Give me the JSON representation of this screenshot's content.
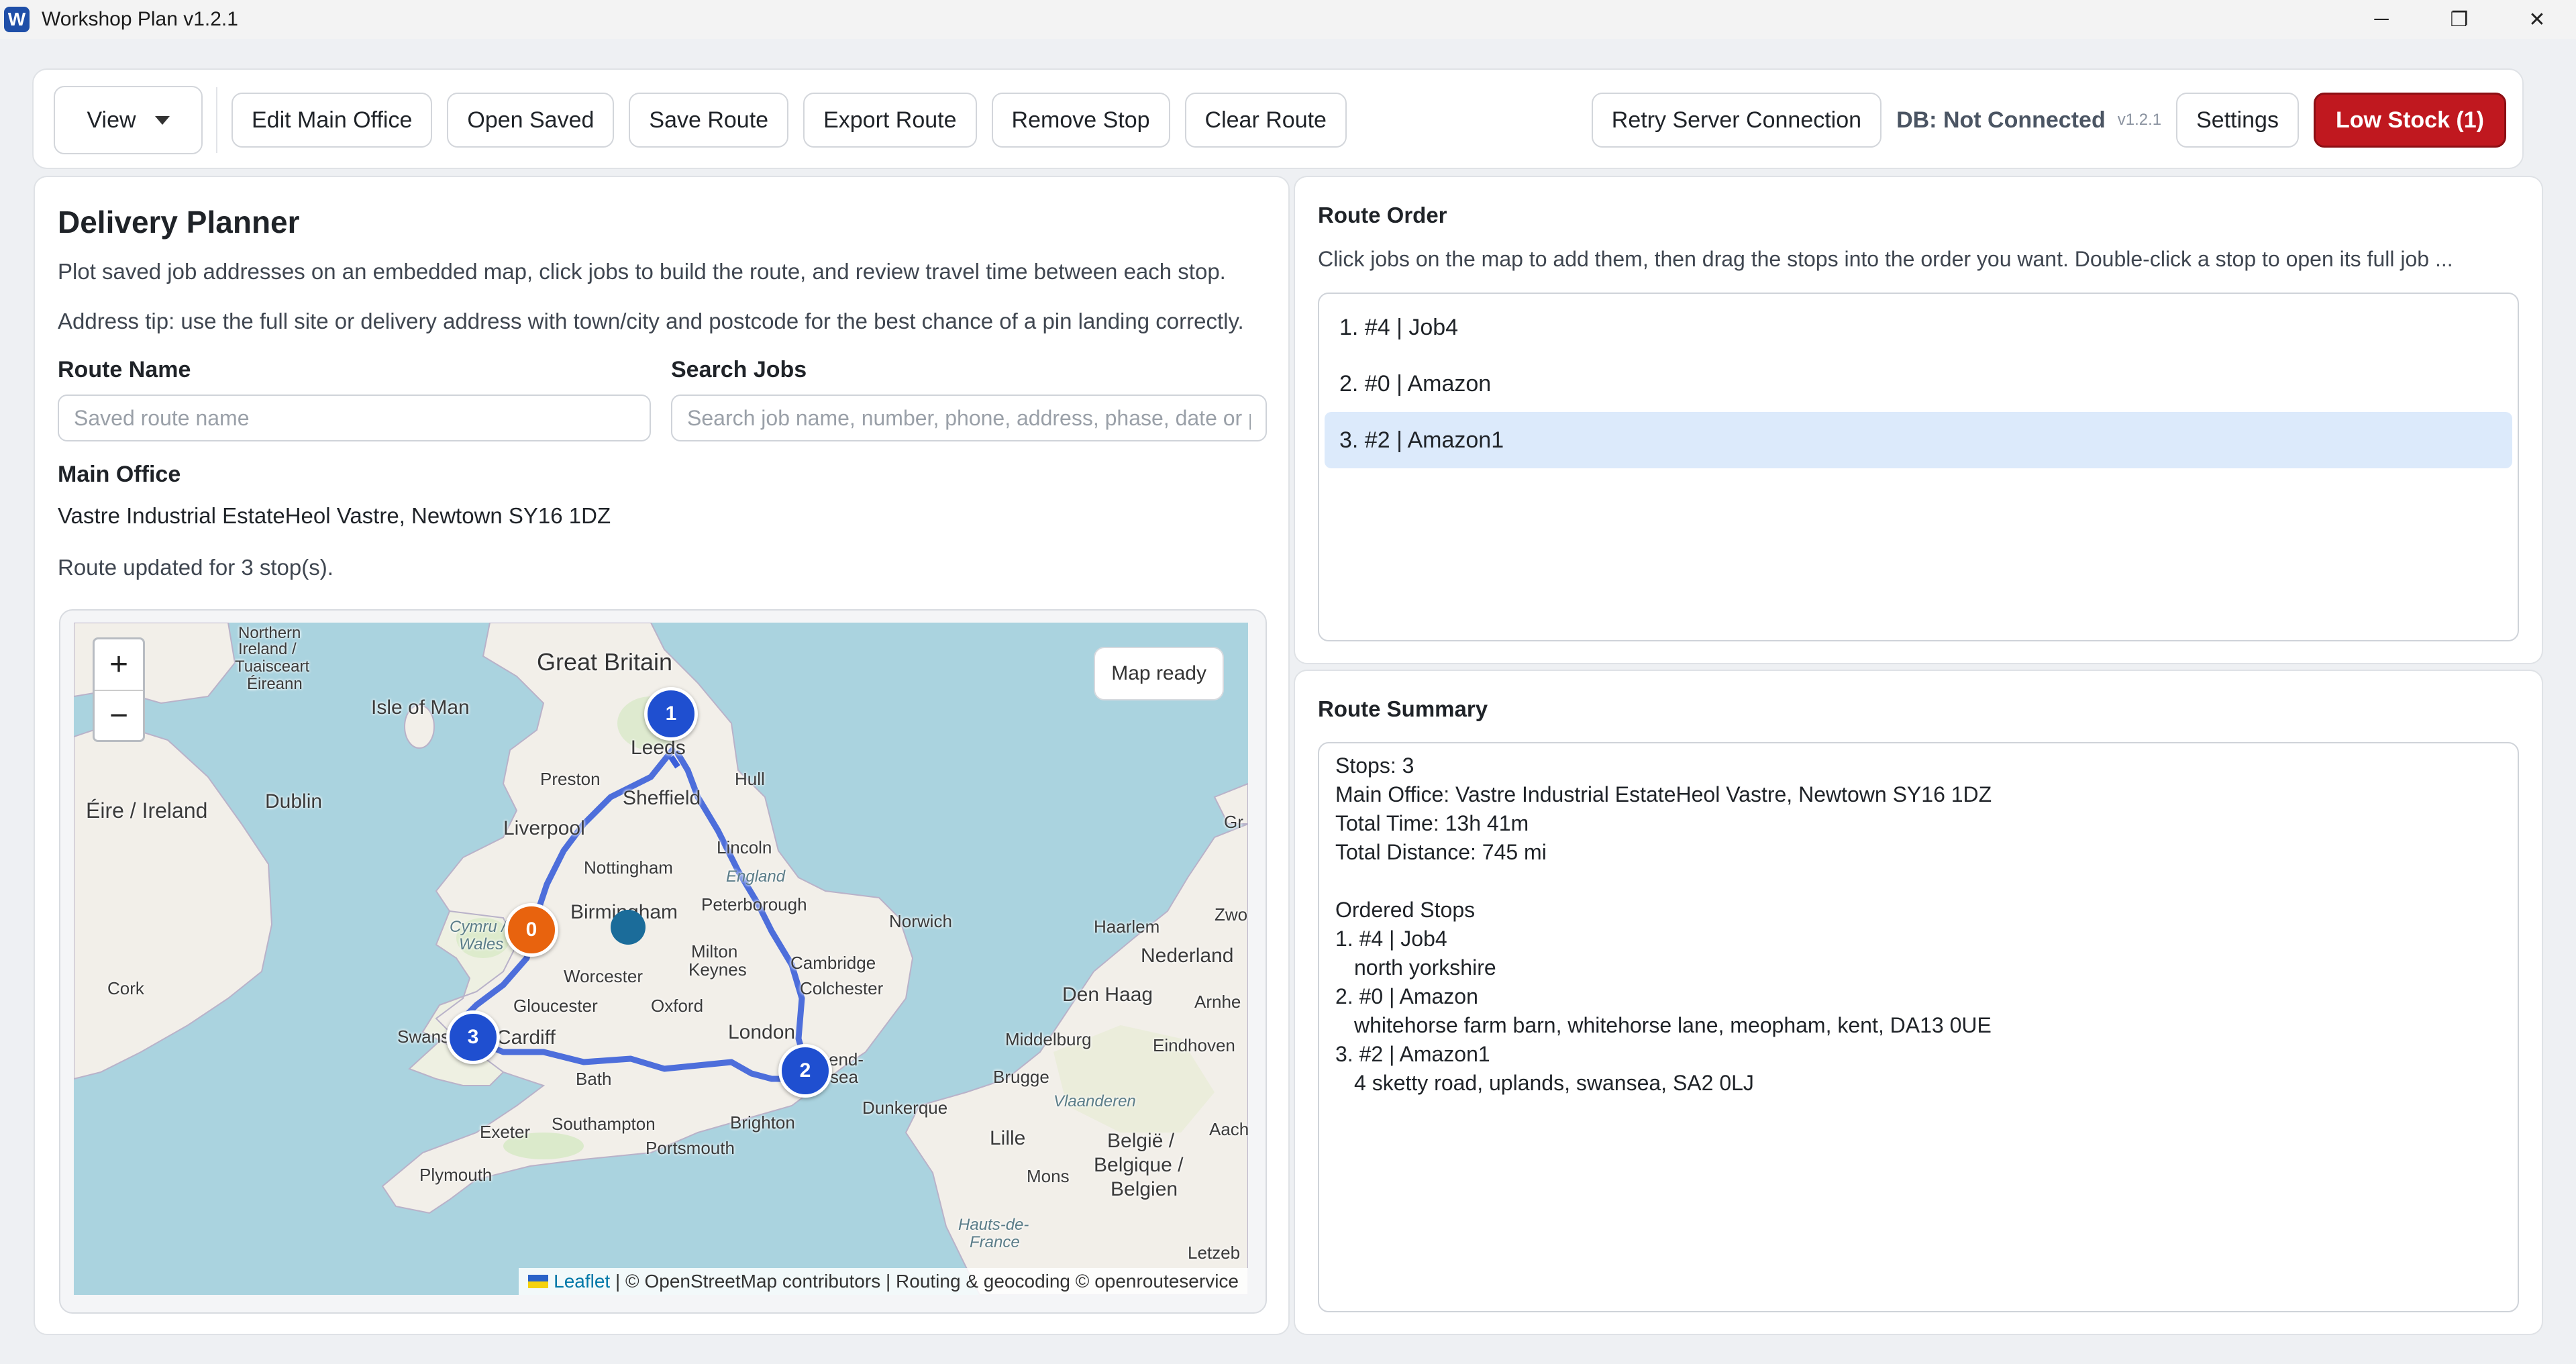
{
  "window": {
    "title": "Workshop Plan v1.2.1",
    "logo_letter": "W",
    "minimize": "─",
    "restore": "❐",
    "close": "✕"
  },
  "toolbar": {
    "view_label": "View",
    "edit_main_office": "Edit Main Office",
    "open_saved": "Open Saved",
    "save_route": "Save Route",
    "export_route": "Export Route",
    "remove_stop": "Remove Stop",
    "clear_route": "Clear Route",
    "retry_server": "Retry Server Connection",
    "db_status": "DB: Not Connected",
    "version": "v1.2.1",
    "settings": "Settings",
    "low_stock": "Low Stock (1)",
    "low_stock_color": "#c0181f"
  },
  "planner": {
    "title": "Delivery Planner",
    "description": "Plot saved job addresses on an embedded map, click jobs to build the route, and review travel time between each stop.",
    "address_tip": "Address tip: use the full site or delivery address with town/city and postcode for the best chance of a pin landing correctly.",
    "route_name_label": "Route Name",
    "route_name_value": "",
    "route_name_placeholder": "Saved route name",
    "search_label": "Search Jobs",
    "search_value": "",
    "search_placeholder": "Search job name, number, phone, address, phase, date or p",
    "main_office_label": "Main Office",
    "main_office_address": "Vastre Industrial EstateHeol Vastre, Newtown SY16 1DZ",
    "route_status": "Route updated for 3 stop(s)."
  },
  "map": {
    "zoom_in": "+",
    "zoom_out": "−",
    "status": "Map ready",
    "attribution_leaflet": "Leaflet",
    "attribution_rest": " | © OpenStreetMap contributors | Routing & geocoding © openrouteservice",
    "route_color": "#3b5fd9",
    "labels": {
      "great_britain": "Great Britain",
      "isle_of_man": "Isle of Man",
      "eire": "Éire / Ireland",
      "dublin": "Dublin",
      "cork": "Cork",
      "northern_ireland": "Northern",
      "ireland_n": "Ireland /",
      "tuaisceart": "Tuaisceart",
      "eireann": "Éireann",
      "preston": "Preston",
      "leeds": "Leeds",
      "hull": "Hull",
      "sheffield": "Sheffield",
      "liverpool": "Liverpool",
      "nottingham": "Nottingham",
      "lincoln": "Lincoln",
      "england": "England",
      "birmingham": "Birmingham",
      "peterborough": "Peterborough",
      "norwich": "Norwich",
      "cymru": "Cymru /",
      "wales": "Wales",
      "milton_keynes_1": "Milton",
      "milton_keynes_2": "Keynes",
      "cambridge": "Cambridge",
      "worcester": "Worcester",
      "colchester": "Colchester",
      "gloucester": "Gloucester",
      "oxford": "Oxford",
      "swansea": "Swans",
      "cardiff": "Cardiff",
      "london": "London",
      "southend": "end-",
      "southend_2": "sea",
      "bath": "Bath",
      "exeter": "Exeter",
      "southampton": "Southampton",
      "brighton": "Brighton",
      "portsmouth": "Portsmouth",
      "plymouth": "Plymouth",
      "haarlem": "Haarlem",
      "den_haag": "Den Haag",
      "nederland": "Nederland",
      "zwo": "Zwo",
      "arnhem": "Arnhe",
      "eindhoven": "Eindhoven",
      "middelburg": "Middelburg",
      "brugge": "Brugge",
      "dunkerque": "Dunkerque",
      "vlaanderen": "Vlaanderen",
      "lille": "Lille",
      "belgie": "België /",
      "belgique": "Belgique /",
      "belgien": "Belgien",
      "mons": "Mons",
      "hauts": "Hauts-de-",
      "france": "France",
      "aach": "Aach",
      "letzeb": "Letzeb",
      "gr": "Gr"
    },
    "markers": {
      "m1": "1",
      "m0": "0",
      "m2": "2",
      "m3": "3"
    }
  },
  "route_order": {
    "title": "Route Order",
    "hint": "Click jobs on the map to add them, then drag the stops into the order you want. Double-click a stop to open its full job ...",
    "items": [
      {
        "label": "1. #4 | Job4"
      },
      {
        "label": "2. #0 | Amazon"
      },
      {
        "label": "3. #2 | Amazon1"
      }
    ]
  },
  "route_summary": {
    "title": "Route Summary",
    "stops": "Stops: 3",
    "main_office": "Main Office: Vastre Industrial EstateHeol Vastre, Newtown SY16 1DZ",
    "total_time": "Total Time: 13h 41m",
    "total_distance": "Total Distance: 745 mi",
    "ordered_heading": "Ordered Stops",
    "stops_list": [
      {
        "label": "1. #4 | Job4",
        "address": "north yorkshire"
      },
      {
        "label": "2. #0 | Amazon",
        "address": "whitehorse farm barn, whitehorse lane, meopham, kent, DA13 0UE"
      },
      {
        "label": "3. #2 | Amazon1",
        "address": "4 sketty road, uplands, swansea, SA2 0LJ"
      }
    ]
  }
}
